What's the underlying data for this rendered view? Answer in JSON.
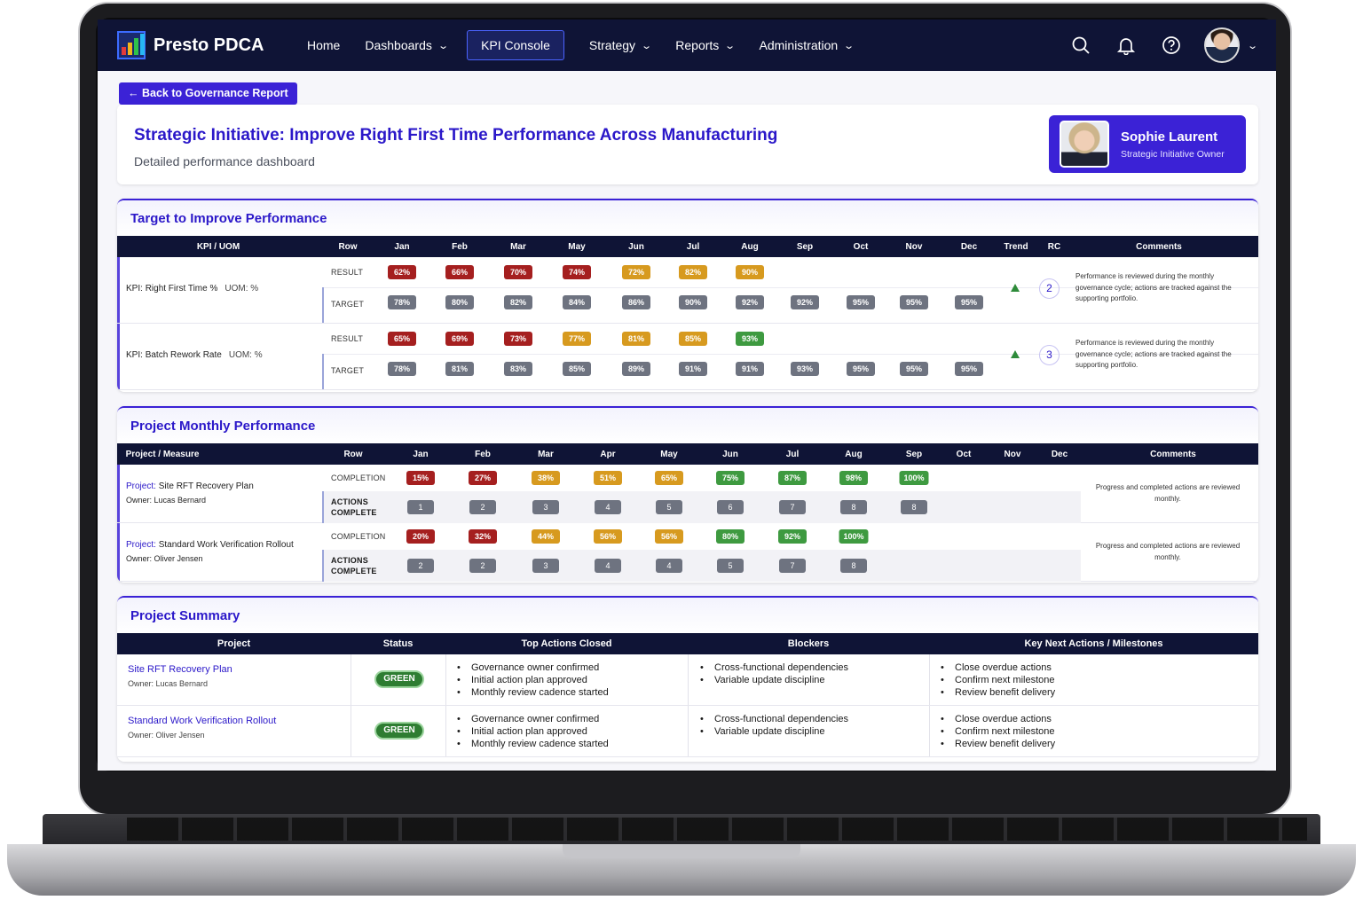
{
  "app": {
    "name": "Presto PDCA"
  },
  "nav": {
    "items": [
      {
        "label": "Home",
        "dropdown": false,
        "active": false
      },
      {
        "label": "Dashboards",
        "dropdown": true,
        "active": false
      },
      {
        "label": "KPI Console",
        "dropdown": false,
        "active": true
      },
      {
        "label": "Strategy",
        "dropdown": true,
        "active": false
      },
      {
        "label": "Reports",
        "dropdown": true,
        "active": false
      },
      {
        "label": "Administration",
        "dropdown": true,
        "active": false
      }
    ],
    "icons": [
      "search-icon",
      "bell-icon",
      "help-icon",
      "user-avatar"
    ]
  },
  "back_button": "← Back to Governance Report",
  "header": {
    "title": "Strategic Initiative: Improve Right First Time Performance Across Manufacturing",
    "subtitle": "Detailed performance dashboard",
    "owner": {
      "name": "Sophie Laurent",
      "role": "Strategic Initiative Owner"
    }
  },
  "target_section": {
    "title": "Target to Improve Performance",
    "columns": {
      "kpi": "KPI / UOM",
      "row": "Row",
      "months": [
        "Jan",
        "Feb",
        "Mar",
        "May",
        "Jun",
        "Jul",
        "Aug",
        "Sep",
        "Oct",
        "Nov",
        "Dec"
      ],
      "trend": "Trend",
      "rc": "RC",
      "comments": "Comments"
    },
    "row_labels": {
      "result": "RESULT",
      "target": "TARGET"
    },
    "kpis": [
      {
        "prefix": "KPI:",
        "name": "Right First Time",
        "unit_suffix": "%",
        "uom": "UOM: %",
        "result": [
          {
            "v": "62%",
            "c": "red"
          },
          {
            "v": "66%",
            "c": "red"
          },
          {
            "v": "70%",
            "c": "red"
          },
          {
            "v": "74%",
            "c": "red"
          },
          {
            "v": "72%",
            "c": "amber"
          },
          {
            "v": "82%",
            "c": "amber"
          },
          {
            "v": "90%",
            "c": "amber"
          }
        ],
        "target": [
          "78%",
          "80%",
          "82%",
          "84%",
          "86%",
          "90%",
          "92%",
          "92%",
          "95%",
          "95%",
          "95%"
        ],
        "trend": "up",
        "rc": "2",
        "comment": "Performance is reviewed during the monthly governance cycle; actions are tracked against the supporting portfolio."
      },
      {
        "prefix": "KPI:",
        "name": "Batch Rework Rate",
        "unit_suffix": "",
        "uom": "UOM: %",
        "result": [
          {
            "v": "65%",
            "c": "red"
          },
          {
            "v": "69%",
            "c": "red"
          },
          {
            "v": "73%",
            "c": "red"
          },
          {
            "v": "77%",
            "c": "amber"
          },
          {
            "v": "81%",
            "c": "amber"
          },
          {
            "v": "85%",
            "c": "amber"
          },
          {
            "v": "93%",
            "c": "green"
          }
        ],
        "target": [
          "78%",
          "81%",
          "83%",
          "85%",
          "89%",
          "91%",
          "91%",
          "93%",
          "95%",
          "95%",
          "95%"
        ],
        "trend": "up",
        "rc": "3",
        "comment": "Performance is reviewed during the monthly governance cycle; actions are tracked against the supporting portfolio."
      }
    ]
  },
  "project_section": {
    "title": "Project Monthly Performance",
    "columns": {
      "project": "Project / Measure",
      "row": "Row",
      "months": [
        "Jan",
        "Feb",
        "Mar",
        "Apr",
        "May",
        "Jun",
        "Jul",
        "Aug",
        "Sep",
        "Oct",
        "Nov",
        "Dec"
      ],
      "comments": "Comments"
    },
    "row_labels": {
      "completion": "COMPLETION",
      "actions": [
        "ACTIONS",
        "COMPLETE"
      ]
    },
    "projects": [
      {
        "prefix": "Project:",
        "name": "Site RFT Recovery Plan",
        "owner": "Owner: Lucas Bernard",
        "completion": [
          {
            "v": "15%",
            "c": "red"
          },
          {
            "v": "27%",
            "c": "red"
          },
          {
            "v": "38%",
            "c": "amber"
          },
          {
            "v": "51%",
            "c": "amber"
          },
          {
            "v": "65%",
            "c": "amber"
          },
          {
            "v": "75%",
            "c": "green"
          },
          {
            "v": "87%",
            "c": "green"
          },
          {
            "v": "98%",
            "c": "green"
          },
          {
            "v": "100%",
            "c": "green"
          }
        ],
        "actions": [
          "1",
          "2",
          "3",
          "4",
          "5",
          "6",
          "7",
          "8",
          "8"
        ],
        "comment": "Progress and completed actions are reviewed monthly."
      },
      {
        "prefix": "Project:",
        "name": "Standard Work Verification Rollout",
        "owner": "Owner: Oliver Jensen",
        "completion": [
          {
            "v": "20%",
            "c": "red"
          },
          {
            "v": "32%",
            "c": "red"
          },
          {
            "v": "44%",
            "c": "amber"
          },
          {
            "v": "56%",
            "c": "amber"
          },
          {
            "v": "56%",
            "c": "amber"
          },
          {
            "v": "80%",
            "c": "green"
          },
          {
            "v": "92%",
            "c": "green"
          },
          {
            "v": "100%",
            "c": "green"
          }
        ],
        "actions": [
          "2",
          "2",
          "3",
          "4",
          "4",
          "5",
          "7",
          "8"
        ],
        "comment": "Progress and completed actions are reviewed monthly."
      }
    ]
  },
  "summary_section": {
    "title": "Project Summary",
    "columns": [
      "Project",
      "Status",
      "Top Actions Closed",
      "Blockers",
      "Key Next Actions / Milestones"
    ],
    "rows": [
      {
        "project": "Site RFT Recovery Plan",
        "owner": "Owner: Lucas Bernard",
        "status": "GREEN",
        "actions_closed": [
          "Governance owner confirmed",
          "Initial action plan approved",
          "Monthly review cadence started"
        ],
        "blockers": [
          "Cross-functional dependencies",
          "Variable update discipline"
        ],
        "next_actions": [
          "Close overdue actions",
          "Confirm next milestone",
          "Review benefit delivery"
        ]
      },
      {
        "project": "Standard Work Verification Rollout",
        "owner": "Owner: Oliver Jensen",
        "status": "GREEN",
        "actions_closed": [
          "Governance owner confirmed",
          "Initial action plan approved",
          "Monthly review cadence started"
        ],
        "blockers": [
          "Cross-functional dependencies",
          "Variable update discipline"
        ],
        "next_actions": [
          "Close overdue actions",
          "Confirm next milestone",
          "Review benefit delivery"
        ]
      }
    ]
  }
}
